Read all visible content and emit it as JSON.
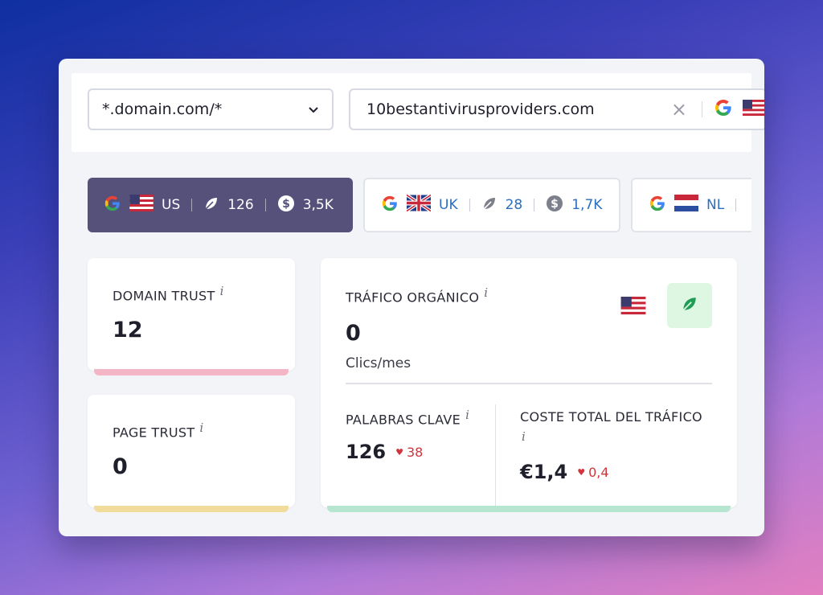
{
  "topbar": {
    "scope_select": {
      "value": "*.domain.com/*"
    },
    "search": {
      "value": "10bestantivirusproviders.com"
    }
  },
  "database_chips": [
    {
      "country": "US",
      "keywords": "126",
      "traffic_cost": "3,5K",
      "active": true
    },
    {
      "country": "UK",
      "keywords": "28",
      "traffic_cost": "1,7K",
      "active": false
    },
    {
      "country": "NL",
      "keywords": "",
      "traffic_cost": "",
      "active": false
    }
  ],
  "domain_trust": {
    "label": "DOMAIN TRUST",
    "value": "12",
    "info": "i"
  },
  "page_trust": {
    "label": "PAGE TRUST",
    "value": "0",
    "info": "i"
  },
  "organic_traffic": {
    "label": "TRÁFICO ORGÁNICO",
    "info": "i",
    "value": "0",
    "unit": "Clics/mes",
    "keywords": {
      "label": "PALABRAS CLAVE",
      "info": "i",
      "value": "126",
      "change": "38"
    },
    "traffic_cost": {
      "label": "COSTE TOTAL DEL TRÁFICO",
      "info": "i",
      "value": "€1,4",
      "change": "0,4"
    }
  },
  "colors": {
    "active_chip": "#55517a",
    "chip_link": "#2b6fbf",
    "domain_trust_accent": "#f4b6c6",
    "page_trust_accent": "#f1dc9c",
    "organic_accent": "#b6e6cf",
    "negative": "#d0353d"
  },
  "icons": [
    "chevron-down-icon",
    "clear-icon",
    "google-icon",
    "us-flag-icon",
    "uk-flag-icon",
    "nl-flag-icon",
    "leaf-icon",
    "dollar-icon"
  ]
}
